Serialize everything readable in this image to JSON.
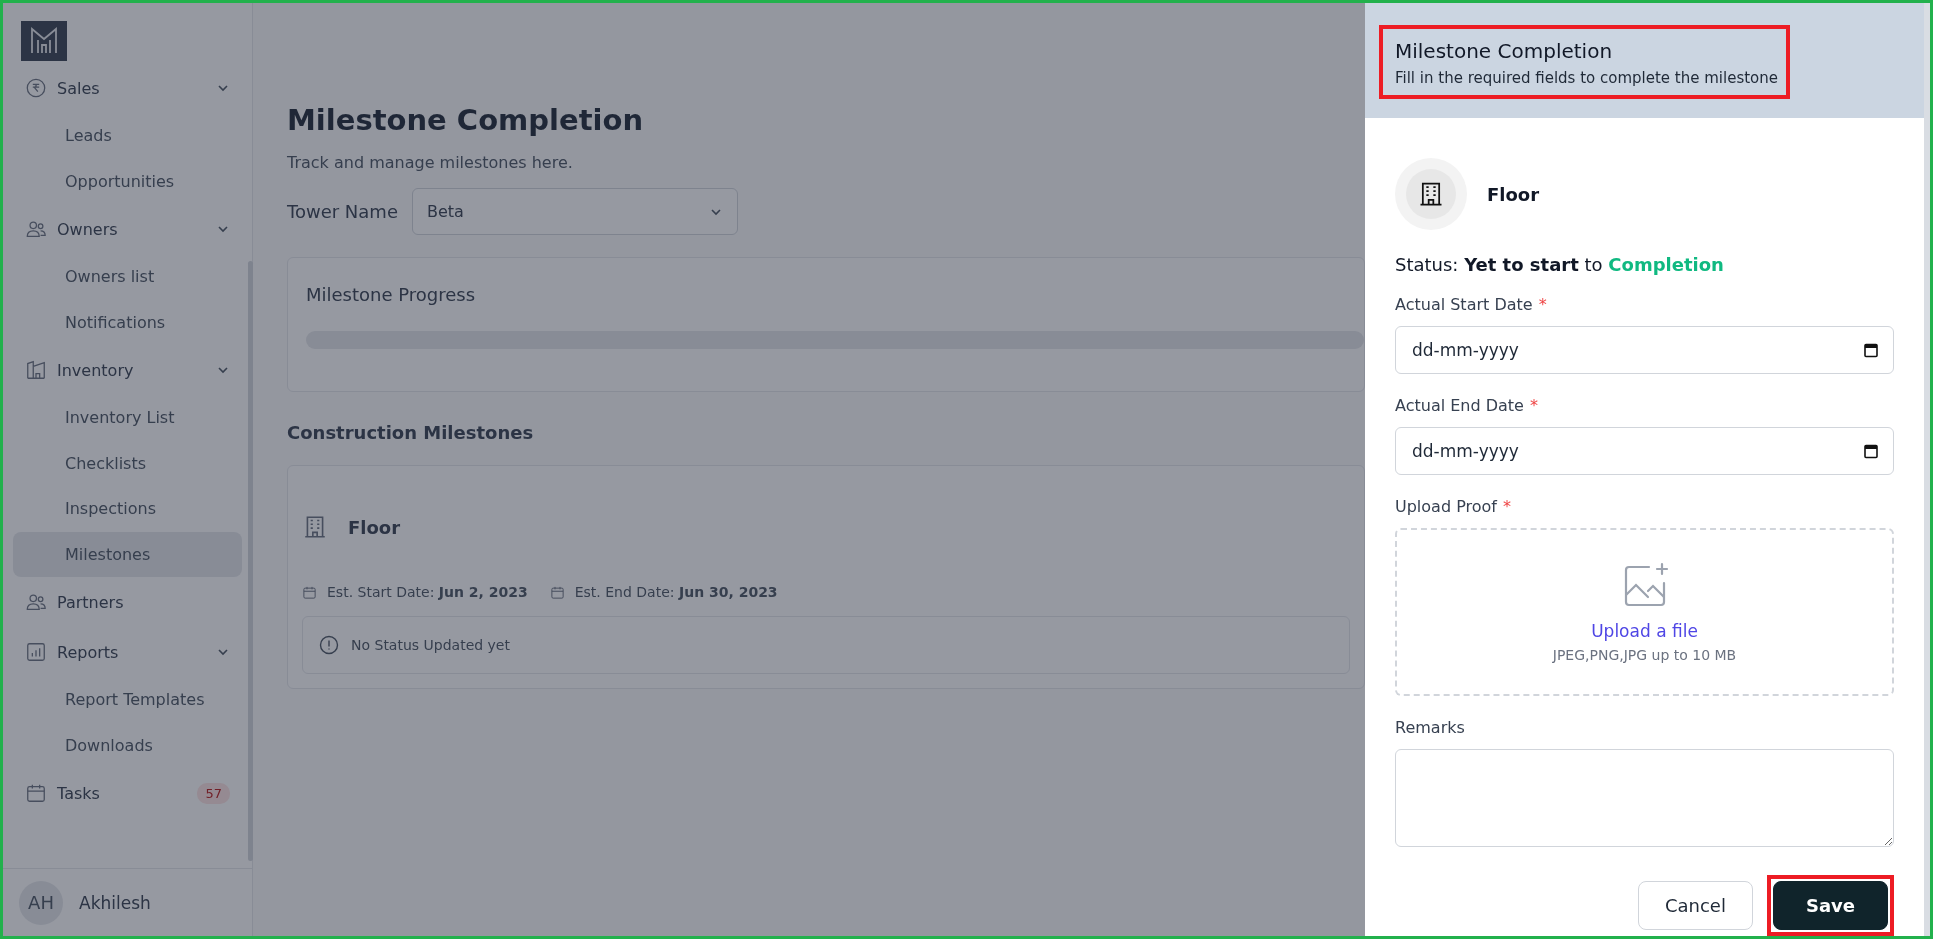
{
  "sidebar": {
    "items": [
      {
        "label": "Sales",
        "expanded": true,
        "children": [
          {
            "label": "Leads",
            "selected": false
          },
          {
            "label": "Opportunities",
            "selected": false
          }
        ]
      },
      {
        "label": "Owners",
        "expanded": true,
        "children": [
          {
            "label": "Owners list",
            "selected": false
          },
          {
            "label": "Notifications",
            "selected": false
          }
        ]
      },
      {
        "label": "Inventory",
        "expanded": true,
        "children": [
          {
            "label": "Inventory List",
            "selected": false
          },
          {
            "label": "Checklists",
            "selected": false
          },
          {
            "label": "Inspections",
            "selected": false
          },
          {
            "label": "Milestones",
            "selected": true
          }
        ]
      },
      {
        "label": "Partners"
      },
      {
        "label": "Reports",
        "expanded": true,
        "children": [
          {
            "label": "Report Templates",
            "selected": false
          },
          {
            "label": "Downloads",
            "selected": false
          }
        ]
      },
      {
        "label": "Tasks",
        "badge": "57"
      }
    ],
    "user": {
      "initials": "AH",
      "name": "Akhilesh"
    }
  },
  "page": {
    "title": "Milestone Completion",
    "subtitle": "Track and manage milestones here.",
    "tower": {
      "label": "Tower Name",
      "value": "Beta"
    },
    "progress": {
      "title": "Milestone Progress",
      "level": 0
    },
    "section_title": "Construction Milestones",
    "milestone": {
      "name": "Floor",
      "start_label": "Est. Start Date:",
      "start": "Jun 2, 2023",
      "end_label": "Est. End Date:",
      "end": "Jun 30, 2023",
      "status": "No Status Updated yet"
    }
  },
  "drawer": {
    "title": "Milestone Completion",
    "subtitle": "Fill in the required fields to complete the milestone",
    "item": "Floor",
    "status": {
      "label": "Status:",
      "from": "Yet to start",
      "joiner": "to",
      "to": "Completion"
    },
    "fields": [
      {
        "kind": "date",
        "label": "Actual Start Date",
        "required_mark": "*",
        "placeholder": "dd-mm-yyyy"
      },
      {
        "kind": "date",
        "label": "Actual End Date",
        "required_mark": "*",
        "placeholder": "dd-mm-yyyy"
      },
      {
        "kind": "upload",
        "label": "Upload Proof",
        "required_mark": "*",
        "link": "Upload a file",
        "hint": "JPEG,PNG,JPG up to 10 MB"
      },
      {
        "kind": "textarea",
        "label": "Remarks"
      }
    ],
    "buttons": [
      {
        "label": "Cancel",
        "kind": "secondary"
      },
      {
        "label": "Save",
        "kind": "primary",
        "highlighted": true
      }
    ]
  }
}
